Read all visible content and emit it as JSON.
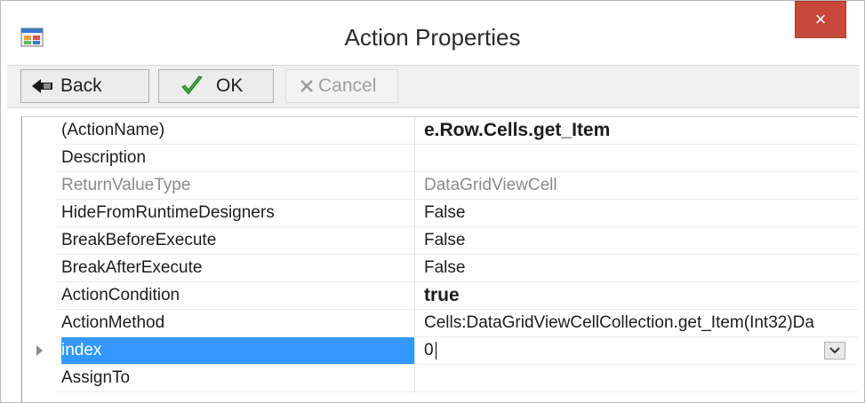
{
  "window": {
    "title": "Action Properties",
    "close_label": "×",
    "colors": {
      "close": "#c9483c",
      "selection": "#3399ff"
    }
  },
  "toolbar": {
    "back_label": "Back",
    "ok_label": "OK",
    "cancel_label": "Cancel",
    "icons": {
      "back": "back-arrow-icon",
      "ok": "checkmark-icon",
      "cancel": "x-icon"
    }
  },
  "properties": [
    {
      "name": "(ActionName)",
      "value": "e.Row.Cells.get_Item"
    },
    {
      "name": "Description",
      "value": ""
    },
    {
      "name": "ReturnValueType",
      "value": "DataGridViewCell"
    },
    {
      "name": "HideFromRuntimeDesigners",
      "value": "False"
    },
    {
      "name": "BreakBeforeExecute",
      "value": "False"
    },
    {
      "name": "BreakAfterExecute",
      "value": "False"
    },
    {
      "name": "ActionCondition",
      "value": "true"
    },
    {
      "name": "ActionMethod",
      "value": "Cells:DataGridViewCellCollection.get_Item(Int32)Da"
    },
    {
      "name": "index",
      "value": "0"
    },
    {
      "name": "AssignTo",
      "value": ""
    }
  ]
}
